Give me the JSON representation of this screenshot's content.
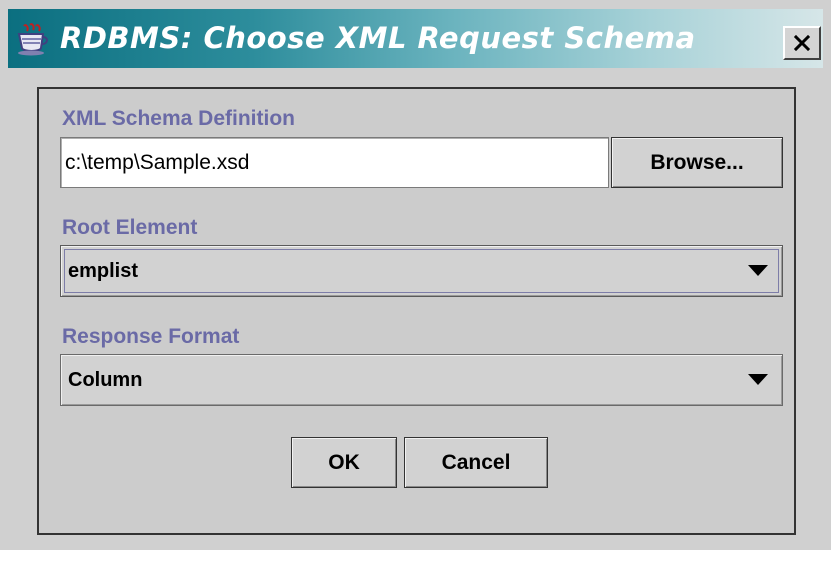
{
  "window": {
    "title": "RDBMS: Choose XML Request Schema",
    "title_bar_color": "#0b6f80",
    "close_icon_glyph": "×"
  },
  "schema": {
    "label": "XML Schema Definition",
    "value": "c:\\temp\\Sample.xsd",
    "browse_label": "Browse..."
  },
  "root_element": {
    "label": "Root Element",
    "selected": "emplist"
  },
  "response_format": {
    "label": "Response Format",
    "selected": "Column"
  },
  "buttons": {
    "ok_label": "OK",
    "cancel_label": "Cancel"
  },
  "colors": {
    "label_text": "#6a6aa6",
    "dialog_background": "#d0d0d0"
  }
}
